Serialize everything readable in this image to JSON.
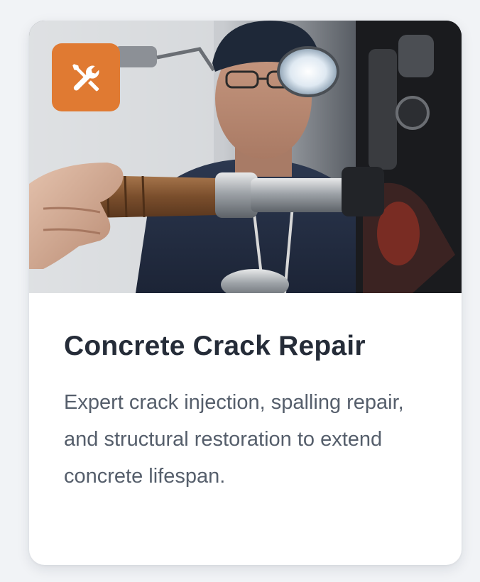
{
  "card": {
    "title": "Concrete Crack Repair",
    "description": "Expert crack injection, spalling repair, and structural restoration to extend concrete lifespan.",
    "icon": "tools-icon",
    "accent_color": "#e07a32"
  }
}
